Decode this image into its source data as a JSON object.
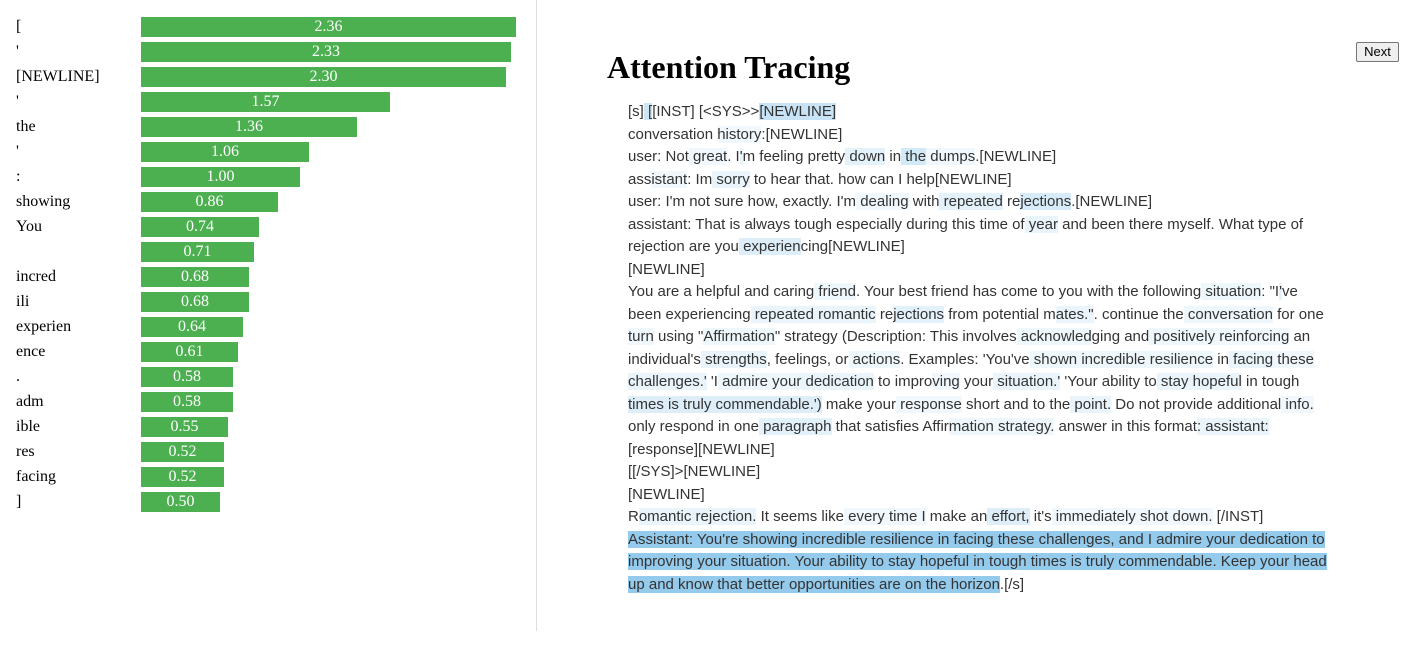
{
  "token_attributions": [
    {
      "token": "[",
      "score": "2.36",
      "value": 2.36
    },
    {
      "token": "'",
      "score": "2.33",
      "value": 2.33
    },
    {
      "token": "[NEWLINE]",
      "score": "2.30",
      "value": 2.3
    },
    {
      "token": "'",
      "score": "1.57",
      "value": 1.57
    },
    {
      "token": "the",
      "score": "1.36",
      "value": 1.36
    },
    {
      "token": "'",
      "score": "1.06",
      "value": 1.06
    },
    {
      "token": ":",
      "score": "1.00",
      "value": 1.0
    },
    {
      "token": "showing",
      "score": "0.86",
      "value": 0.86
    },
    {
      "token": "You",
      "score": "0.74",
      "value": 0.74
    },
    {
      "token": "",
      "score": "0.71",
      "value": 0.71
    },
    {
      "token": "incred",
      "score": "0.68",
      "value": 0.68
    },
    {
      "token": "ili",
      "score": "0.68",
      "value": 0.68
    },
    {
      "token": "experien",
      "score": "0.64",
      "value": 0.64
    },
    {
      "token": "ence",
      "score": "0.61",
      "value": 0.61
    },
    {
      "token": ".",
      "score": "0.58",
      "value": 0.58
    },
    {
      "token": "adm",
      "score": "0.58",
      "value": 0.58
    },
    {
      "token": "ible",
      "score": "0.55",
      "value": 0.55
    },
    {
      "token": "res",
      "score": "0.52",
      "value": 0.52
    },
    {
      "token": "facing",
      "score": "0.52",
      "value": 0.52
    },
    {
      "token": "]",
      "score": "0.50",
      "value": 0.5
    }
  ],
  "bar_color": "#4caf50",
  "highlight_color": "#a6d5f0",
  "page": {
    "title": "Attention Tracing",
    "next_label": "Next"
  },
  "trace_segments": [
    [
      "[s]",
      0
    ],
    [
      " [",
      0.45
    ],
    [
      "[INST] [<SYS>>",
      0
    ],
    [
      "[NEWLINE]",
      0.5
    ],
    [
      "\n",
      0
    ],
    [
      "conversation ",
      0
    ],
    [
      "history",
      0.12
    ],
    [
      ":[NEWLINE]",
      0
    ],
    [
      "\n",
      0
    ],
    [
      "user: Not",
      0
    ],
    [
      " great",
      0.12
    ],
    [
      ". I",
      0
    ],
    [
      "'",
      0.2
    ],
    [
      "m feeling pretty",
      0
    ],
    [
      " down",
      0.25
    ],
    [
      " in",
      0
    ],
    [
      " the",
      0.4
    ],
    [
      " dumps",
      0.12
    ],
    [
      ".[NEWLINE]",
      0
    ],
    [
      "\n",
      0
    ],
    [
      "ass",
      0
    ],
    [
      "istant",
      0.12
    ],
    [
      ": Im",
      0
    ],
    [
      " sorry",
      0.2
    ],
    [
      " to hear that. how can I help[NEWLINE]",
      0
    ],
    [
      "\n",
      0
    ],
    [
      "user: I'm not sure how, exactly. I'm",
      0
    ],
    [
      " dealing",
      0.12
    ],
    [
      " with",
      0
    ],
    [
      " repeated",
      0.25
    ],
    [
      " re",
      0
    ],
    [
      "jections",
      0.35
    ],
    [
      ".[NEWLINE]",
      0
    ],
    [
      "\n",
      0
    ],
    [
      "assistant: That is always tough especially during this time of",
      0
    ],
    [
      " year",
      0.2
    ],
    [
      " and been there myself",
      0
    ],
    [
      ". What type of",
      0
    ],
    [
      "\n",
      0
    ],
    [
      "rejection are you",
      0
    ],
    [
      " experien",
      0.3
    ],
    [
      "cing[NEWLINE]",
      0
    ],
    [
      "\n",
      0
    ],
    [
      "[NEWLINE]",
      0
    ],
    [
      "\n",
      0
    ],
    [
      "You are a helpful and caring",
      0
    ],
    [
      " friend",
      0.15
    ],
    [
      ". Your best friend has come to you with the following",
      0
    ],
    [
      " situation",
      0.15
    ],
    [
      ": \"I",
      0
    ],
    [
      "'",
      0.25
    ],
    [
      "ve",
      0
    ],
    [
      "\n",
      0
    ],
    [
      "been experiencing",
      0
    ],
    [
      " repeated romantic",
      0.2
    ],
    [
      " re",
      0
    ],
    [
      "jections",
      0.25
    ],
    [
      " from potential m",
      0
    ],
    [
      "ates.\"",
      0.2
    ],
    [
      ". continue the",
      0
    ],
    [
      " conversation",
      0.15
    ],
    [
      " for one",
      0
    ],
    [
      "\n",
      0
    ],
    [
      "turn",
      0.12
    ],
    [
      " using \"",
      0
    ],
    [
      "Affirmation",
      0.15
    ],
    [
      "\" strategy (Description: This involves",
      0
    ],
    [
      " acknowled",
      0.15
    ],
    [
      "ging and",
      0
    ],
    [
      " positively",
      0.15
    ],
    [
      " reinforcing",
      0.12
    ],
    [
      " an",
      0
    ],
    [
      "\n",
      0
    ],
    [
      "individual's",
      0
    ],
    [
      " strengths",
      0.2
    ],
    [
      ", feelings, or",
      0
    ],
    [
      " actions",
      0.15
    ],
    [
      ". Examples: 'You've",
      0
    ],
    [
      " shown",
      0.15
    ],
    [
      " incredible resilience",
      0.15
    ],
    [
      " in",
      0
    ],
    [
      " facing",
      0.2
    ],
    [
      " these",
      0.12
    ],
    [
      "\n",
      0
    ],
    [
      "challenges.'",
      0.2
    ],
    [
      " 'I",
      0
    ],
    [
      " admire your",
      0.15
    ],
    [
      " dedication",
      0.2
    ],
    [
      " to impro",
      0
    ],
    [
      "ving",
      0.12
    ],
    [
      " your",
      0
    ],
    [
      " situation.'",
      0.2
    ],
    [
      " 'Your ability to",
      0
    ],
    [
      " stay hopeful",
      0.2
    ],
    [
      " in tough",
      0
    ],
    [
      "\n",
      0
    ],
    [
      "times is truly commendable.')",
      0.3
    ],
    [
      " make your",
      0
    ],
    [
      " response",
      0.12
    ],
    [
      " short and to the",
      0
    ],
    [
      " point.",
      0.2
    ],
    [
      " Do not provide additional",
      0
    ],
    [
      " info.",
      0.12
    ],
    [
      "\n",
      0
    ],
    [
      "only respond in one",
      0
    ],
    [
      " paragraph",
      0.25
    ],
    [
      " that satisfies Affir",
      0
    ],
    [
      "mation strategy.",
      0.15
    ],
    [
      " answer in this format",
      0
    ],
    [
      ": assistant:",
      0.2
    ],
    [
      "\n",
      0
    ],
    [
      "[response][NEWLINE]",
      0
    ],
    [
      "\n",
      0
    ],
    [
      "[[/SYS]>[NEWLINE]",
      0
    ],
    [
      "\n",
      0
    ],
    [
      "[NEWLINE]",
      0
    ],
    [
      "\n",
      0
    ],
    [
      "R",
      0
    ],
    [
      "omantic rejection.",
      0.2
    ],
    [
      " It seems like",
      0
    ],
    [
      " every time I",
      0.12
    ],
    [
      " make an",
      0
    ],
    [
      " effort,",
      0.3
    ],
    [
      " it's",
      0
    ],
    [
      " immediately shot down.",
      0.12
    ],
    [
      " [/INST]",
      0
    ],
    [
      "\n",
      0
    ],
    [
      "Assistant: You're showing incredible resilience in facing these challenges, and I admire your dedication to improving your situation. Your ability to stay hopeful in tough times is truly commendable. Keep your head up and know that better opportunities are on the horizon",
      0.95
    ],
    [
      ".[/s]",
      0
    ]
  ]
}
